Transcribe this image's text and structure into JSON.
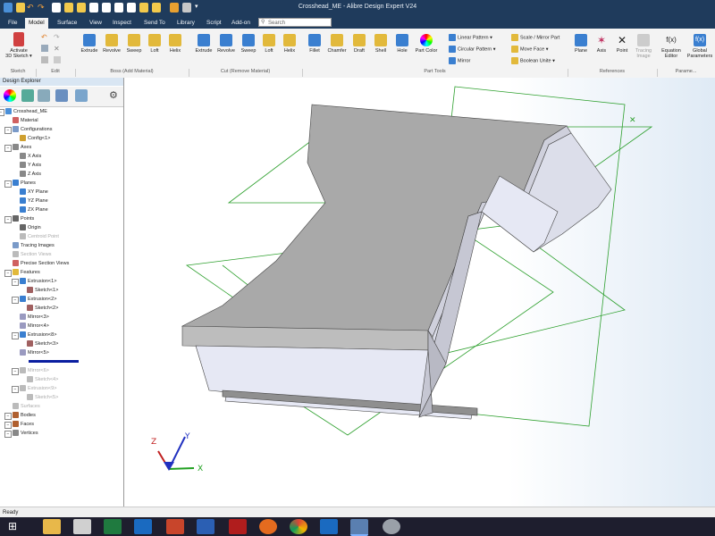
{
  "window": {
    "title": "Crosshead_ME - Alibre Design Expert V24"
  },
  "menu": {
    "items": [
      "File",
      "Model",
      "Surface",
      "View",
      "Inspect",
      "Send To",
      "Library",
      "Script",
      "Add-on"
    ],
    "active": "Model",
    "search_placeholder": "Search"
  },
  "ribbon": {
    "sketch": {
      "activate_label": "Activate",
      "activate_sub": "3D Sketch ▾",
      "group": "Sketch"
    },
    "edit": {
      "group": "Edit"
    },
    "boss": {
      "buttons": [
        "Extrude",
        "Revolve",
        "Sweep",
        "Loft",
        "Helix"
      ],
      "group": "Boss (Add Material)"
    },
    "cut": {
      "buttons": [
        "Extrude",
        "Revolve",
        "Sweep",
        "Loft",
        "Helix"
      ],
      "group": "Cut (Remove Material)"
    },
    "tools": {
      "buttons": [
        "Fillet",
        "Chamfer",
        "Draft",
        "Shell",
        "Hole",
        "Part Color"
      ],
      "group": "Part Tools"
    },
    "pattern": {
      "items": [
        "Linear Pattern ▾",
        "Circular Pattern ▾",
        "Mirror"
      ]
    },
    "transform": {
      "items": [
        "Scale / Mirror Part",
        "Move Face ▾",
        "Boolean Unite ▾"
      ]
    },
    "refs": {
      "buttons": [
        "Plane",
        "Axis",
        "Point",
        "Tracing Image"
      ],
      "group": "References"
    },
    "params": {
      "buttons": [
        "Equation Editor",
        "Global Parameters"
      ],
      "group": "Parame..."
    }
  },
  "explorer": {
    "title": "Design Explorer",
    "tree": [
      {
        "label": "Crosshead_ME",
        "grey": false
      },
      {
        "label": "Material",
        "grey": false
      },
      {
        "label": "Configurations",
        "grey": false
      },
      {
        "label": "Config<1>",
        "grey": false
      },
      {
        "label": "Axes",
        "grey": false
      },
      {
        "label": "X Axis",
        "grey": false
      },
      {
        "label": "Y Axis",
        "grey": false
      },
      {
        "label": "Z Axis",
        "grey": false
      },
      {
        "label": "Planes",
        "grey": false
      },
      {
        "label": "XY Plane",
        "grey": false
      },
      {
        "label": "YZ Plane",
        "grey": false
      },
      {
        "label": "ZX Plane",
        "grey": false
      },
      {
        "label": "Points",
        "grey": false
      },
      {
        "label": "Origin",
        "grey": false
      },
      {
        "label": "Centroid Point",
        "grey": true
      },
      {
        "label": "Tracing Images",
        "grey": false
      },
      {
        "label": "Section Views",
        "grey": true
      },
      {
        "label": "Precise Section Views",
        "grey": false
      },
      {
        "label": "Features",
        "grey": false
      },
      {
        "label": "Extrusion<1>",
        "grey": false
      },
      {
        "label": "Sketch<1>",
        "grey": false
      },
      {
        "label": "Extrusion<2>",
        "grey": false
      },
      {
        "label": "Sketch<2>",
        "grey": false
      },
      {
        "label": "Mirror<3>",
        "grey": false
      },
      {
        "label": "Mirror<4>",
        "grey": false
      },
      {
        "label": "Extrusion<8>",
        "grey": false
      },
      {
        "label": "Sketch<3>",
        "grey": false
      },
      {
        "label": "Mirror<5>",
        "grey": false
      },
      {
        "label": "",
        "grey": false
      },
      {
        "label": "Mirror<6>",
        "grey": true
      },
      {
        "label": "Sketch<4>",
        "grey": true
      },
      {
        "label": "Extrusion<9>",
        "grey": true
      },
      {
        "label": "Sketch<5>",
        "grey": true
      },
      {
        "label": "Surfaces",
        "grey": true
      },
      {
        "label": "Bodies",
        "grey": false
      },
      {
        "label": "Faces",
        "grey": false
      },
      {
        "label": "Vertices",
        "grey": false
      }
    ]
  },
  "status": {
    "text": "Ready"
  },
  "colors": {
    "titlebar": "#1f3b5c",
    "model_face": "#a9a9a9",
    "side_face": "#e6e8f4",
    "plane": "#2ea02e",
    "rollback_bar": "#0a1ea0"
  }
}
